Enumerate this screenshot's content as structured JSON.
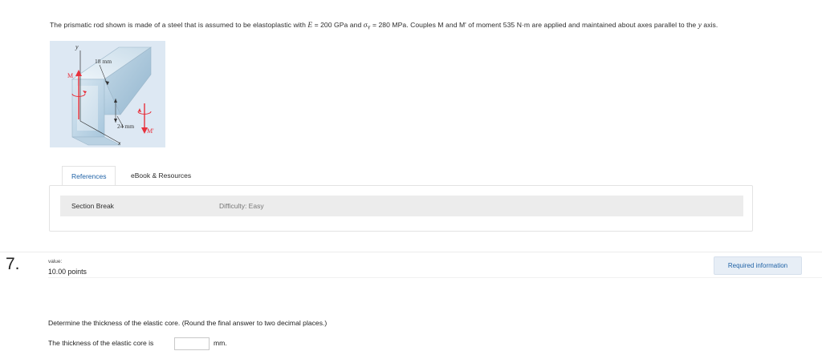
{
  "problem": {
    "t1": "The prismatic rod shown is made of a steel that is assumed to be elastoplastic with ",
    "E_var": "E",
    "t2": " = 200 GPa and ",
    "sigma_var": "σ",
    "sigma_sub": "Y",
    "t3": " = 280 MPa. Couples M and M' of moment 535 N·m are applied and maintained about axes parallel to the ",
    "y_var": "y",
    "t4": " axis."
  },
  "figure": {
    "label_y": "y",
    "label_dim_top": "18 mm",
    "label_M": "M",
    "label_dim_bottom": "24 mm",
    "label_M_prime": "M'",
    "label_x": "x",
    "moment_color": "#e8313c"
  },
  "tabs": {
    "references": "References",
    "ebook": "eBook & Resources"
  },
  "section": {
    "section_break": "Section Break",
    "difficulty": "Difficulty: Easy"
  },
  "question_meta": {
    "number": "7.",
    "value_label": "value:",
    "points": "10.00 points",
    "required_button": "Required information"
  },
  "question": {
    "prompt": "Determine the thickness of the elastic core. (Round the final answer to two decimal places.)",
    "answer_label": "The thickness of the elastic core is",
    "answer_value": "",
    "answer_unit": "mm."
  }
}
